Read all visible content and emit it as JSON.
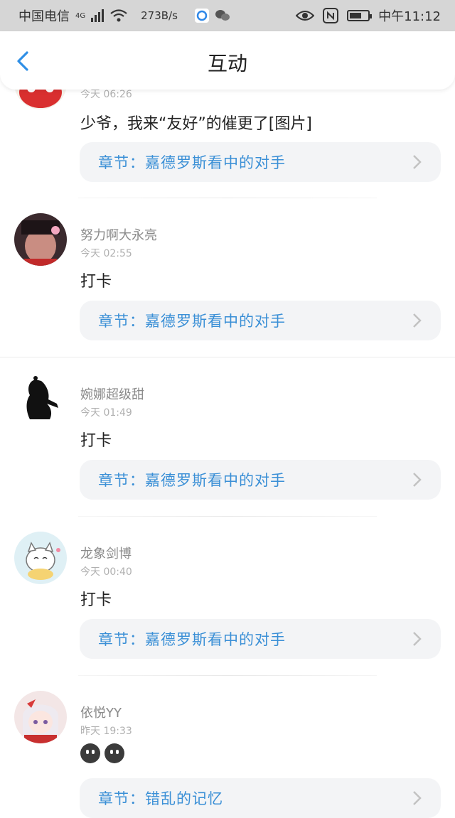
{
  "status_bar": {
    "carrier": "中国电信",
    "network": "4G",
    "speed": "273B/s",
    "time": "中午11:12"
  },
  "header": {
    "title": "互动"
  },
  "items": [
    {
      "username": "",
      "time": "今天 06:26",
      "message": "少爷，我来“友好”的催更了[图片]",
      "chapter": "章节：嘉德罗斯看中的对手"
    },
    {
      "username": "努力啊大永亮",
      "time": "今天 02:55",
      "message": "打卡",
      "chapter": "章节：嘉德罗斯看中的对手"
    },
    {
      "username": "婉娜超级甜",
      "time": "今天 01:49",
      "message": "打卡",
      "chapter": "章节：嘉德罗斯看中的对手"
    },
    {
      "username": "龙象剑博",
      "time": "今天 00:40",
      "message": "打卡",
      "chapter": "章节：嘉德罗斯看中的对手"
    },
    {
      "username": "依悦YY",
      "time": "昨天 19:33",
      "message": "",
      "chapter": "章节：错乱的记忆"
    }
  ],
  "colors": {
    "accent": "#3a8fd6",
    "chip_bg": "#f3f4f6",
    "status_bg": "#d6d6d6"
  },
  "icons": [
    "back-chevron-icon",
    "chevron-right-icon",
    "wifi-icon",
    "signal-icon",
    "eye-icon",
    "nfc-icon",
    "battery-icon",
    "wechat-icon"
  ]
}
